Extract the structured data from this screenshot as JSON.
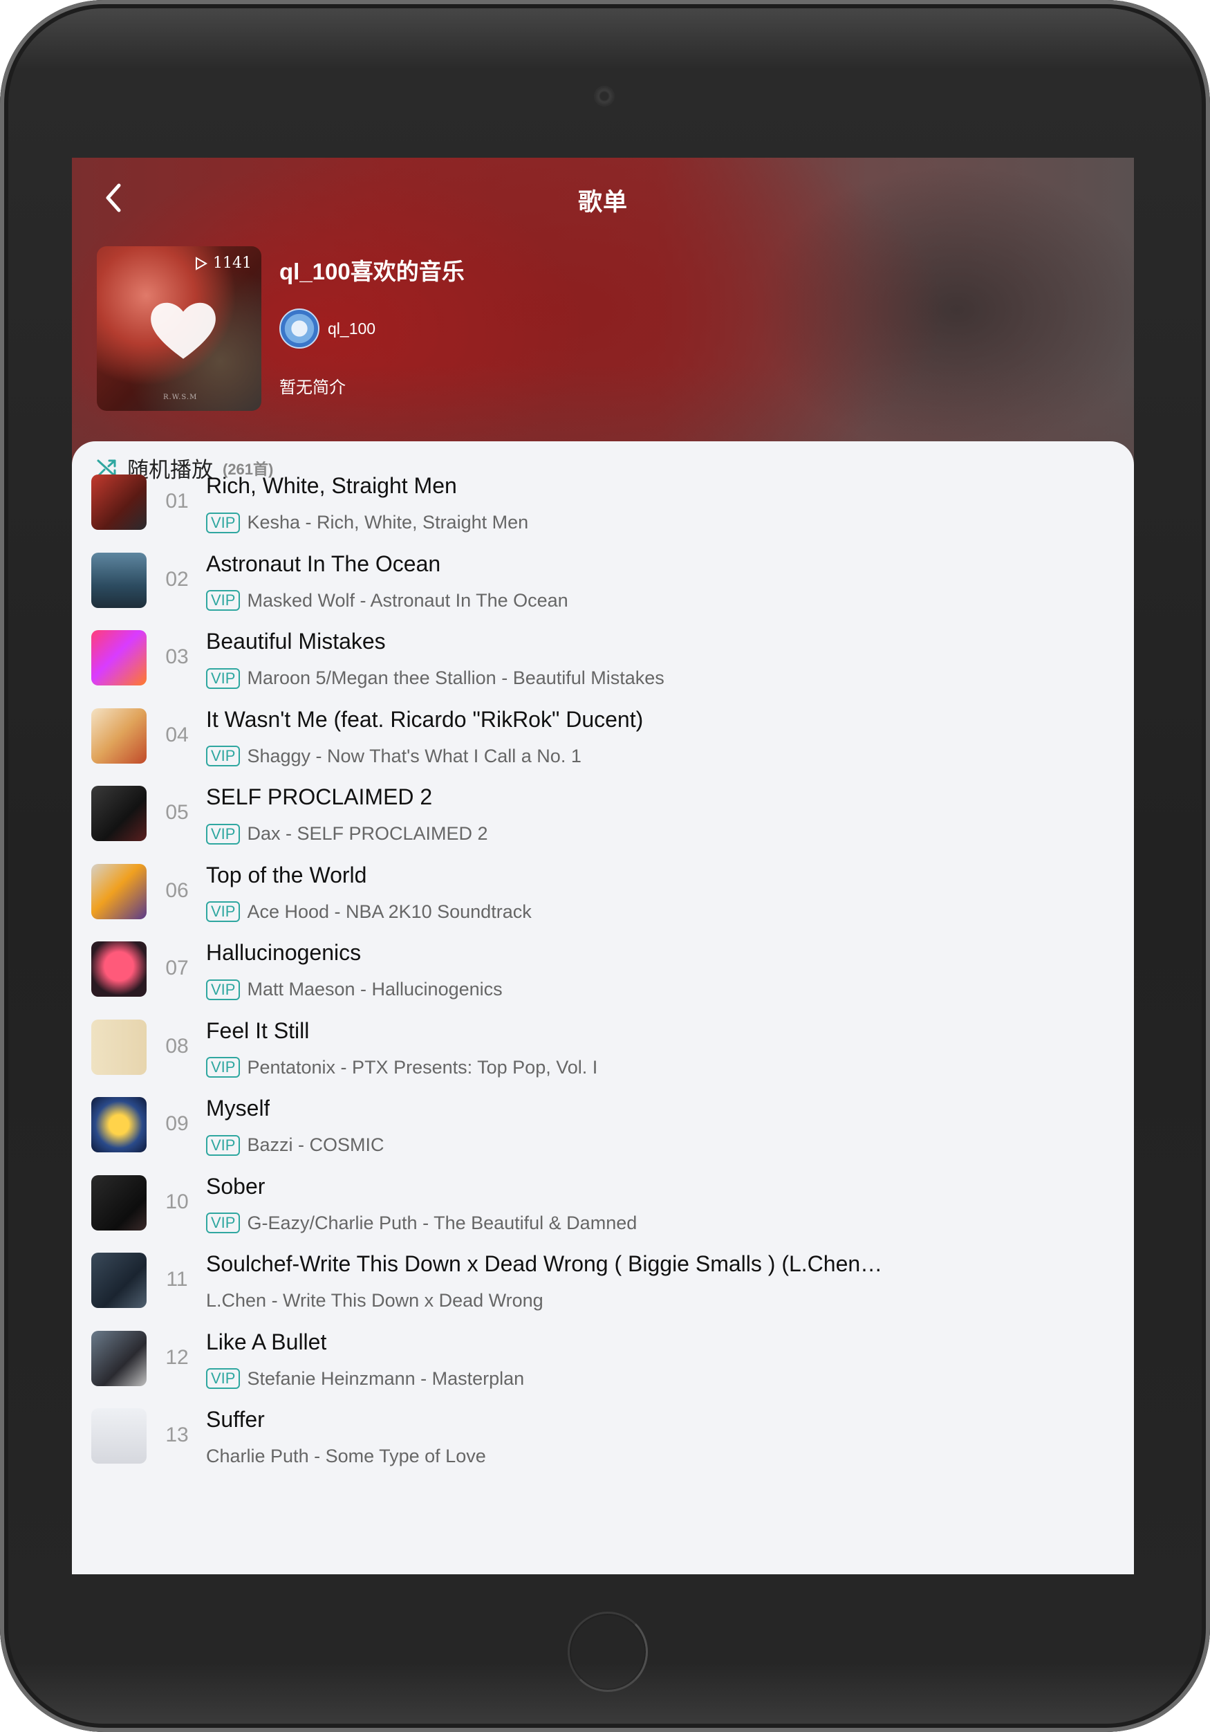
{
  "header": {
    "title": "歌单",
    "back_icon": "chevron-left-icon"
  },
  "playlist": {
    "name": "ql_100喜欢的音乐",
    "play_count": "1141",
    "creator": "ql_100",
    "description": "暂无简介",
    "cover_mark": "R.W.S.M"
  },
  "shuffle": {
    "label": "随机播放",
    "count": "(261首)"
  },
  "colors": {
    "accent": "#2fa7a0",
    "header_red": "#8e2626"
  },
  "songs": [
    {
      "index": "01",
      "title": "Rich, White, Straight Men",
      "artist": "Kesha - Rich, White, Straight Men",
      "vip": true,
      "vip_label": "VIP"
    },
    {
      "index": "02",
      "title": "Astronaut In The Ocean",
      "artist": "Masked Wolf - Astronaut In The Ocean",
      "vip": true,
      "vip_label": "VIP"
    },
    {
      "index": "03",
      "title": "Beautiful Mistakes",
      "artist": "Maroon 5/Megan thee Stallion - Beautiful Mistakes",
      "vip": true,
      "vip_label": "VIP"
    },
    {
      "index": "04",
      "title": "It Wasn't Me (feat. Ricardo \"RikRok\" Ducent)",
      "artist": "Shaggy - Now That's What I Call a No. 1",
      "vip": true,
      "vip_label": "VIP"
    },
    {
      "index": "05",
      "title": "SELF PROCLAIMED 2",
      "artist": "Dax - SELF PROCLAIMED 2",
      "vip": true,
      "vip_label": "VIP"
    },
    {
      "index": "06",
      "title": "Top of the World",
      "artist": "Ace Hood - NBA 2K10 Soundtrack",
      "vip": true,
      "vip_label": "VIP"
    },
    {
      "index": "07",
      "title": "Hallucinogenics",
      "artist": "Matt Maeson - Hallucinogenics",
      "vip": true,
      "vip_label": "VIP"
    },
    {
      "index": "08",
      "title": "Feel It Still",
      "artist": "Pentatonix - PTX Presents: Top Pop, Vol. I",
      "vip": true,
      "vip_label": "VIP"
    },
    {
      "index": "09",
      "title": "Myself",
      "artist": "Bazzi - COSMIC",
      "vip": true,
      "vip_label": "VIP"
    },
    {
      "index": "10",
      "title": "Sober",
      "artist": "G-Eazy/Charlie Puth - The Beautiful & Damned",
      "vip": true,
      "vip_label": "VIP"
    },
    {
      "index": "11",
      "title": "Soulchef-Write This Down x Dead Wrong ( Biggie Smalls ) (L.Chen…",
      "artist": "L.Chen - Write This Down x Dead Wrong",
      "vip": false,
      "vip_label": ""
    },
    {
      "index": "12",
      "title": "Like A Bullet",
      "artist": "Stefanie Heinzmann - Masterplan",
      "vip": true,
      "vip_label": "VIP"
    },
    {
      "index": "13",
      "title": "Suffer",
      "artist": "Charlie Puth - Some Type of Love",
      "vip": false,
      "vip_label": ""
    }
  ]
}
